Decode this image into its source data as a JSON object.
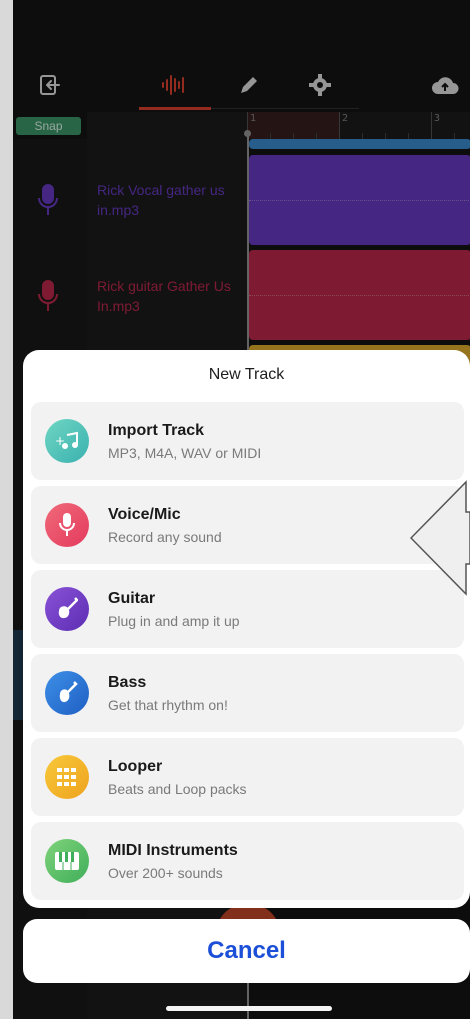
{
  "toolbar": {
    "icons": [
      "exit-icon",
      "waveform-icon",
      "pencil-icon",
      "gear-icon",
      "cloud-upload-icon"
    ],
    "active_tab": "waveform-icon",
    "accent": "#e2432f"
  },
  "timeline": {
    "snap_label": "Snap",
    "ruler_numbers": [
      "1",
      "2",
      "3"
    ],
    "tracks": [
      {
        "name": "Rick Vocal gather us in.mp3",
        "color": "#6a3bc8"
      },
      {
        "name": "Rick guitar Gather Us In.mp3",
        "color": "#c3294f"
      }
    ],
    "clip_colors": [
      "#3d8fd6",
      "#6a3bc8",
      "#c3294f",
      "#e6b32e"
    ]
  },
  "sheet": {
    "title": "New Track",
    "options": [
      {
        "title": "Import Track",
        "subtitle": "MP3, M4A, WAV or MIDI",
        "icon": "import-music-icon"
      },
      {
        "title": "Voice/Mic",
        "subtitle": "Record any sound",
        "icon": "microphone-icon"
      },
      {
        "title": "Guitar",
        "subtitle": "Plug in and amp it up",
        "icon": "guitar-icon"
      },
      {
        "title": "Bass",
        "subtitle": "Get that rhythm on!",
        "icon": "bass-icon"
      },
      {
        "title": "Looper",
        "subtitle": "Beats and Loop packs",
        "icon": "looper-grid-icon"
      },
      {
        "title": "MIDI Instruments",
        "subtitle": "Over 200+ sounds",
        "icon": "piano-keys-icon"
      }
    ]
  },
  "cancel_label": "Cancel",
  "colors": {
    "cancel_text": "#1c4fd8",
    "snap_bg": "#3e9b6d"
  }
}
